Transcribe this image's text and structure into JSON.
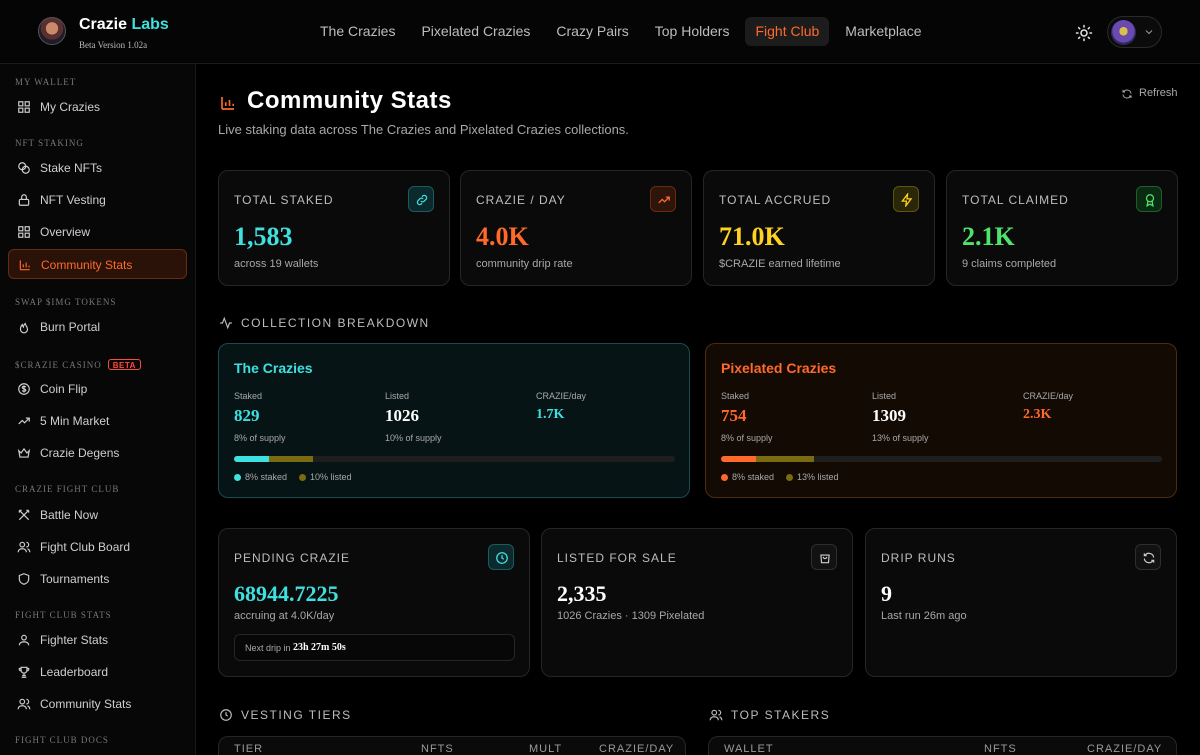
{
  "app": {
    "brand_main": "Crazie",
    "brand_accent": "Labs",
    "version": "Beta Version 1.02a"
  },
  "nav": [
    {
      "label": "The Crazies",
      "active": false
    },
    {
      "label": "Pixelated Crazies",
      "active": false
    },
    {
      "label": "Crazy Pairs",
      "active": false
    },
    {
      "label": "Top Holders",
      "active": false
    },
    {
      "label": "Fight Club",
      "active": true
    },
    {
      "label": "Marketplace",
      "active": false
    }
  ],
  "sidebar": {
    "sections": [
      {
        "title": "MY WALLET",
        "items": [
          {
            "label": "My Crazies",
            "icon": "grid-icon"
          }
        ]
      },
      {
        "title": "NFT STAKING",
        "items": [
          {
            "label": "Stake NFTs",
            "icon": "coins-icon"
          },
          {
            "label": "NFT Vesting",
            "icon": "lock-icon"
          },
          {
            "label": "Overview",
            "icon": "grid-icon"
          },
          {
            "label": "Community Stats",
            "icon": "bar-chart-icon",
            "active": true
          }
        ]
      },
      {
        "title": "SWAP $IMG TOKENS",
        "items": [
          {
            "label": "Burn Portal",
            "icon": "flame-icon"
          }
        ]
      },
      {
        "title": "$CRAZIE CASINO",
        "badge": "BETA",
        "items": [
          {
            "label": "Coin Flip",
            "icon": "dollar-circle-icon"
          },
          {
            "label": "5 Min Market",
            "icon": "trending-icon"
          },
          {
            "label": "Crazie Degens",
            "icon": "crown-icon"
          }
        ]
      },
      {
        "title": "CRAZIE FIGHT CLUB",
        "items": [
          {
            "label": "Battle Now",
            "icon": "swords-icon"
          },
          {
            "label": "Fight Club Board",
            "icon": "users-icon"
          },
          {
            "label": "Tournaments",
            "icon": "shield-icon"
          }
        ]
      },
      {
        "title": "FIGHT CLUB STATS",
        "items": [
          {
            "label": "Fighter Stats",
            "icon": "user-icon"
          },
          {
            "label": "Leaderboard",
            "icon": "trophy-icon"
          },
          {
            "label": "Community Stats",
            "icon": "users-icon"
          }
        ]
      },
      {
        "title": "FIGHT CLUB DOCS",
        "items": []
      }
    ]
  },
  "page": {
    "title": "Community Stats",
    "subtitle": "Live staking data across The Crazies and Pixelated Crazies collections.",
    "refresh_label": "Refresh"
  },
  "stats": [
    {
      "label": "TOTAL STAKED",
      "value": "1,583",
      "sub": "across 19 wallets",
      "color": "#3fe0e0",
      "icon": "link-icon"
    },
    {
      "label": "CRAZIE / DAY",
      "value": "4.0K",
      "sub": "community drip rate",
      "color": "#ff6a2b",
      "icon": "trending-up-icon"
    },
    {
      "label": "TOTAL ACCRUED",
      "value": "71.0K",
      "sub": "$CRAZIE earned lifetime",
      "color": "#ffd21f",
      "icon": "zap-icon"
    },
    {
      "label": "TOTAL CLAIMED",
      "value": "2.1K",
      "sub": "9 claims completed",
      "color": "#4ee36a",
      "icon": "award-icon"
    }
  ],
  "breakdown": {
    "heading": "COLLECTION BREAKDOWN",
    "collections": [
      {
        "name": "The Crazies",
        "color": "#3fe0e0",
        "staked_label": "Staked",
        "staked": "829",
        "staked_sub": "8% of supply",
        "listed_label": "Listed",
        "listed": "1026",
        "listed_sub": "10% of supply",
        "rate_label": "CRAZIE/day",
        "rate": "1.7K",
        "staked_pct": 8,
        "listed_pct": 10,
        "legend_staked": "8% staked",
        "legend_listed": "10% listed"
      },
      {
        "name": "Pixelated Crazies",
        "color": "#ff6a2b",
        "staked_label": "Staked",
        "staked": "754",
        "staked_sub": "8% of supply",
        "listed_label": "Listed",
        "listed": "1309",
        "listed_sub": "13% of supply",
        "rate_label": "CRAZIE/day",
        "rate": "2.3K",
        "staked_pct": 8,
        "listed_pct": 13,
        "legend_staked": "8% staked",
        "legend_listed": "13% listed"
      }
    ]
  },
  "lower": [
    {
      "label": "PENDING CRAZIE",
      "value": "68944.7225",
      "sub": "accruing at 4.0K/day",
      "color": "#3fe0e0",
      "icon": "clock-icon",
      "next_drip_label": "Next drip in",
      "next_drip_value": "23h 27m 50s"
    },
    {
      "label": "LISTED FOR SALE",
      "value": "2,335",
      "sub": "1026 Crazies · 1309 Pixelated",
      "color": "#ffffff",
      "icon": "bag-icon"
    },
    {
      "label": "DRIP RUNS",
      "value": "9",
      "sub": "Last run 26m ago",
      "color": "#ffffff",
      "icon": "refresh-icon"
    }
  ],
  "vesting": {
    "heading": "VESTING TIERS",
    "columns": [
      "TIER",
      "NFTS",
      "MULT",
      "CRAZIE/DAY"
    ]
  },
  "stakers": {
    "heading": "TOP STAKERS",
    "columns": [
      "WALLET",
      "NFTS",
      "CRAZIE/DAY"
    ]
  }
}
